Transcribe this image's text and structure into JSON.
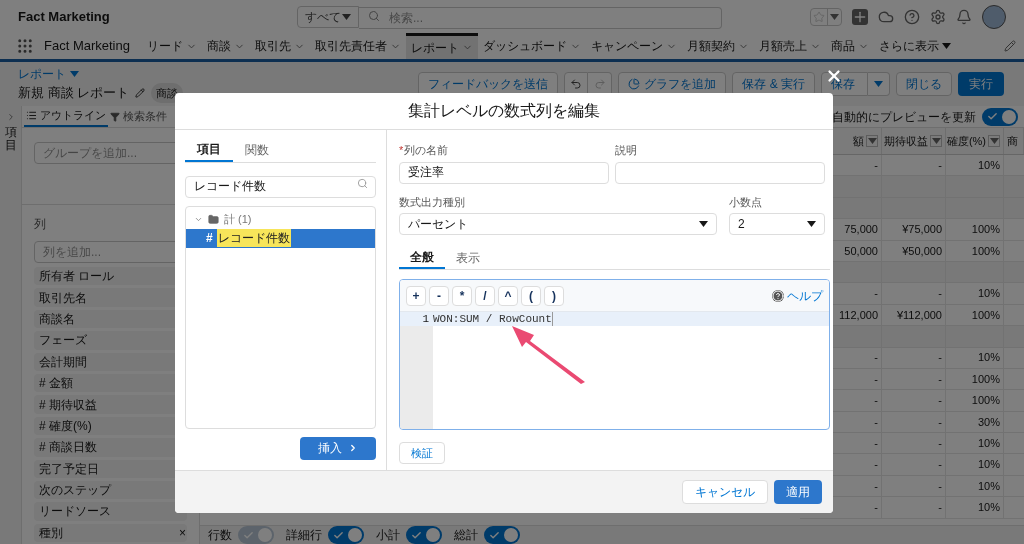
{
  "app_header": {
    "app_name": "Fact Marketing",
    "search_scope": "すべて",
    "search_placeholder": "検索..."
  },
  "nav": {
    "app_name": "Fact Marketing",
    "items": [
      {
        "label": "リード",
        "selected": false,
        "kind": "menu"
      },
      {
        "label": "商談",
        "selected": false,
        "kind": "menu"
      },
      {
        "label": "取引先",
        "selected": false,
        "kind": "menu"
      },
      {
        "label": "取引先責任者",
        "selected": false,
        "kind": "menu"
      },
      {
        "label": "レポート",
        "selected": true,
        "kind": "menu"
      },
      {
        "label": "ダッシュボード",
        "selected": false,
        "kind": "menu"
      },
      {
        "label": "キャンペーン",
        "selected": false,
        "kind": "menu"
      },
      {
        "label": "月額契約",
        "selected": false,
        "kind": "menu"
      },
      {
        "label": "月額売上",
        "selected": false,
        "kind": "menu"
      },
      {
        "label": "商品",
        "selected": false,
        "kind": "menu"
      },
      {
        "label": "さらに表示",
        "selected": false,
        "kind": "more"
      }
    ]
  },
  "page_header": {
    "breadcrumb": "レポート",
    "title": "新規 商談 レポート",
    "badge": "商談",
    "buttons": [
      {
        "kind": "plain",
        "label": "フィードバックを送信"
      },
      {
        "kind": "undo_redo"
      },
      {
        "kind": "chart",
        "label": "グラフを追加"
      },
      {
        "kind": "plain",
        "label": "保存 & 実行"
      },
      {
        "kind": "split",
        "label": "保存"
      },
      {
        "kind": "plain",
        "label": "閉じる"
      },
      {
        "kind": "primary",
        "label": "実行"
      }
    ]
  },
  "side_strip": {
    "label": "項目"
  },
  "sidebar": {
    "tabs": [
      {
        "label": "アウトライン",
        "selected": true
      },
      {
        "label": "検索条件",
        "selected": false
      }
    ],
    "group_placeholder": "グループを追加...",
    "columns_heading": "列",
    "column_placeholder": "列を追加...",
    "columns": [
      {
        "label": "所有者 ロール"
      },
      {
        "label": "取引先名"
      },
      {
        "label": "商談名"
      },
      {
        "label": "フェーズ"
      },
      {
        "label": "会計期間"
      },
      {
        "label": "# 金額"
      },
      {
        "label": "# 期待収益"
      },
      {
        "label": "# 確度(%)"
      },
      {
        "label": "# 商談日数"
      },
      {
        "label": "完了予定日"
      },
      {
        "label": "次のステップ"
      },
      {
        "label": "リードソース"
      },
      {
        "label": "種別",
        "remove_glyph": "×"
      }
    ]
  },
  "preview": {
    "auto_update_label": "自動的にプレビューを更新",
    "auto_update_on": true
  },
  "table": {
    "columns": [
      {
        "label": "額",
        "filter": true
      },
      {
        "label": "期待収益",
        "filter": true
      },
      {
        "label": "確度(%)",
        "filter": true
      },
      {
        "label": "商",
        "filter": false
      }
    ],
    "rows": [
      {
        "kind": "data",
        "cells": [
          "-",
          "-",
          "10%"
        ]
      },
      {
        "kind": "group"
      },
      {
        "kind": "group"
      },
      {
        "kind": "data",
        "cells": [
          "75,000",
          "¥75,000",
          "100%"
        ]
      },
      {
        "kind": "data",
        "cells": [
          "50,000",
          "¥50,000",
          "100%"
        ]
      },
      {
        "kind": "group"
      },
      {
        "kind": "data",
        "cells": [
          "-",
          "-",
          "10%"
        ]
      },
      {
        "kind": "data",
        "cells": [
          "112,000",
          "¥112,000",
          "100%"
        ]
      },
      {
        "kind": "group"
      },
      {
        "kind": "data",
        "cells": [
          "-",
          "-",
          "10%"
        ]
      },
      {
        "kind": "data",
        "cells": [
          "-",
          "-",
          "100%"
        ]
      },
      {
        "kind": "data",
        "cells": [
          "-",
          "-",
          "100%"
        ]
      },
      {
        "kind": "data",
        "cells": [
          "-",
          "-",
          "30%"
        ]
      },
      {
        "kind": "data",
        "cells": [
          "-",
          "-",
          "10%"
        ]
      },
      {
        "kind": "data",
        "cells": [
          "-",
          "-",
          "10%"
        ]
      },
      {
        "kind": "data",
        "cells": [
          "-",
          "-",
          "10%"
        ]
      },
      {
        "kind": "data",
        "cells": [
          "-",
          "-",
          "10%"
        ]
      }
    ]
  },
  "bottom_toggles": [
    {
      "label": "行数",
      "on": true,
      "disabled": true
    },
    {
      "label": "詳細行",
      "on": true,
      "disabled": false
    },
    {
      "label": "小計",
      "on": true,
      "disabled": false
    },
    {
      "label": "総計",
      "on": true,
      "disabled": false
    }
  ],
  "modal": {
    "title": "集計レベルの数式列を編集",
    "left_tabs": [
      {
        "label": "項目",
        "selected": true
      },
      {
        "label": "関数",
        "selected": false
      }
    ],
    "search_value": "レコード件数",
    "tree": [
      {
        "label": "計 (1)",
        "expanded": true,
        "children": [
          {
            "prefix": "#",
            "label": "レコード件数",
            "selected": true,
            "highlighted": true
          }
        ]
      }
    ],
    "insert_button": "挿入",
    "name_label": "列の名前",
    "required_mark": "*",
    "name_value": "受注率",
    "description_label": "説明",
    "output_type_label": "数式出力種別",
    "output_type_value": "パーセント",
    "decimals_label": "小数点",
    "decimals_value": "2",
    "tabs": [
      {
        "label": "全般",
        "selected": true
      },
      {
        "label": "表示",
        "selected": false
      }
    ],
    "operators": [
      "+",
      "-",
      "*",
      "/",
      "^",
      "(",
      ")"
    ],
    "help_link": "ヘルプ",
    "lines": [
      {
        "number": "1",
        "code": "WON:SUM / RowCount",
        "current": true
      }
    ],
    "validate_button": "検証",
    "cancel_button": "キャンセル",
    "apply_button": "適用"
  }
}
